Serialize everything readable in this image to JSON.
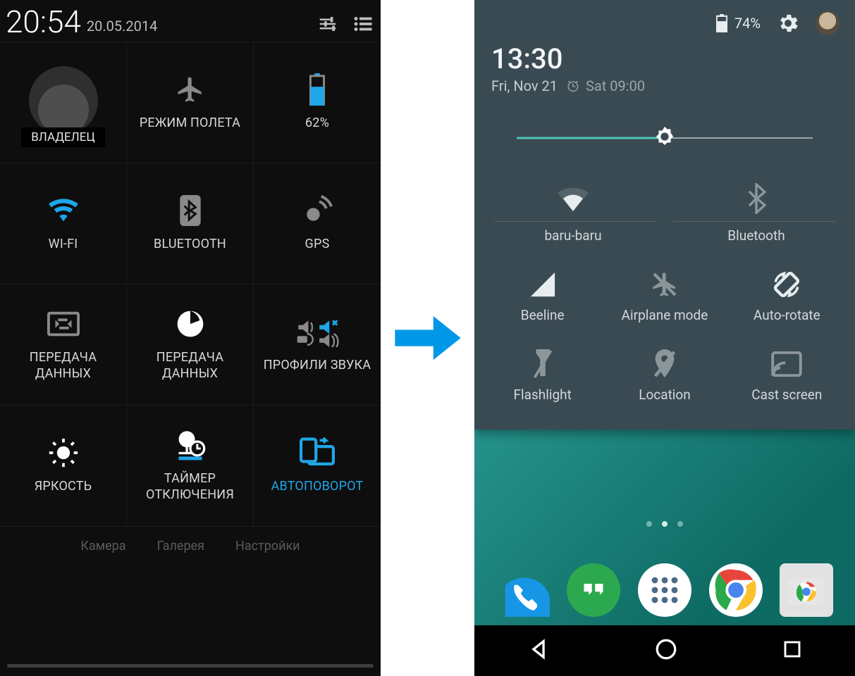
{
  "left": {
    "status": {
      "time": "20:54",
      "date": "20.05.2014"
    },
    "tiles": {
      "owner_label": "ВЛАДЕЛЕЦ",
      "airplane": "РЕЖИМ ПОЛЕТА",
      "battery_pct": "62%",
      "wifi": "WI-FI",
      "bluetooth": "BLUETOOTH",
      "gps": "GPS",
      "data_transfer": "ПЕРЕДАЧА\nДАННЫХ",
      "data_transfer2": "ПЕРЕДАЧА\nДАННЫХ",
      "sound_profiles": "ПРОФИЛИ ЗВУКА",
      "brightness": "ЯРКОСТЬ",
      "sleep_timer": "ТАЙМЕР\nОТКЛЮЧЕНИЯ",
      "autorotate": "АВТОПОВОРОТ"
    },
    "faded_apps": {
      "camera": "Камера",
      "gallery": "Галерея",
      "settings": "Настройки"
    },
    "colors": {
      "accent": "#1ea6e8",
      "muted": "#8a8a8a",
      "fg": "#d8d8d8"
    }
  },
  "right": {
    "statusbar": {
      "battery": "74%"
    },
    "clock": {
      "time": "13:30",
      "date": "Fri, Nov 21",
      "alarm": "Sat 09:00"
    },
    "brightness_slider_pct": 50,
    "tiles": {
      "wifi": "baru-baru",
      "bluetooth": "Bluetooth",
      "cellular": "Beeline",
      "airplane": "Airplane mode",
      "autorotate": "Auto-rotate",
      "flashlight": "Flashlight",
      "location": "Location",
      "cast": "Cast screen"
    },
    "colors": {
      "panel": "#3a4a52",
      "accent": "#52c4b8",
      "fg": "#d2d8da"
    }
  }
}
